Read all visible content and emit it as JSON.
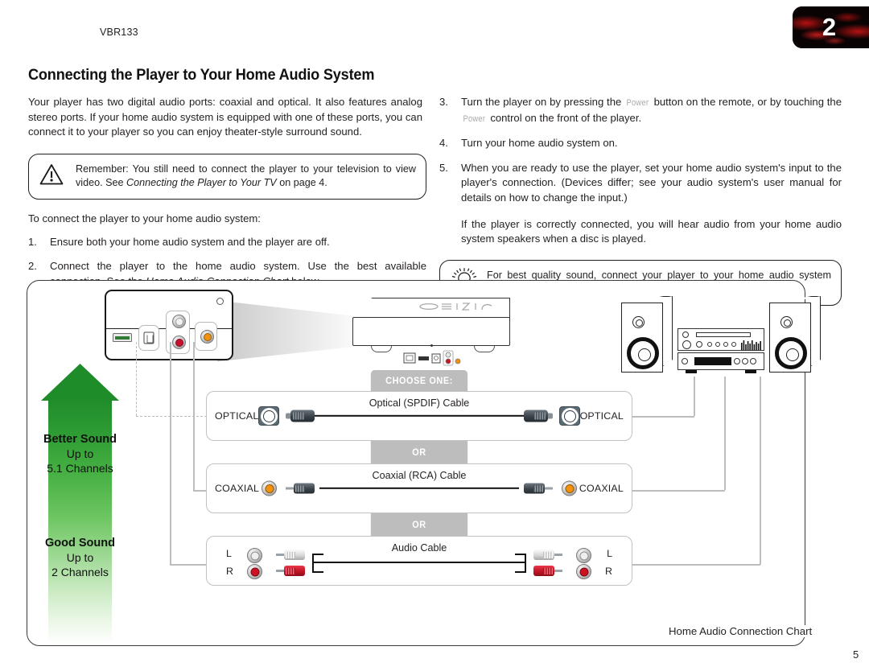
{
  "header": {
    "model_id": "VBR133",
    "chapter_number": "2",
    "page_title": "Connecting the Player to Your Home Audio System",
    "page_number": "5"
  },
  "left_column": {
    "intro": "Your player has two digital audio ports: coaxial and optical. It also features analog stereo ports. If your home audio system is equipped with one of these ports, you can connect it to your player so you can enjoy theater-style surround sound.",
    "warning": {
      "icon": "warning-triangle-icon",
      "text_before": "Remember: You still need to connect the player to your television to view video. See ",
      "text_italic": "Connecting the Player to Your TV",
      "text_after": " on page 4."
    },
    "lead_in": "To connect the player to your home audio system:",
    "steps": [
      {
        "number": "1.",
        "text": "Ensure both your home audio system and the player are off."
      },
      {
        "number": "2.",
        "text_before": "Connect the player to the home audio system. Use the best available connection. See the ",
        "text_italic": "Home Audio Connection Chart",
        "text_after": " below."
      }
    ]
  },
  "right_column": {
    "steps": [
      {
        "number": "3.",
        "part1": "Turn the player on by pressing the ",
        "key1": "Power",
        "part2": " button on the remote, or by touching the ",
        "key2": "Power",
        "part3": " control on the front of the player."
      },
      {
        "number": "4.",
        "text": "Turn your home audio system on."
      },
      {
        "number": "5.",
        "text": "When you are ready to use the player, set your home audio system's input to the player's connection. (Devices differ; see your audio system's user manual for details on how to change the input.)",
        "sub_text": "If the player is correctly connected, you will hear audio from your home audio system speakers when a disc is played."
      }
    ],
    "tip": {
      "icon": "lightbulb-icon",
      "text": "For best quality sound, connect your player to your home audio system using an HDMI cable. See the next page for instructions."
    }
  },
  "chart": {
    "caption": "Home Audio Connection Chart",
    "quality_arrow": {
      "better": {
        "title": "Better Sound",
        "line2": "Up to",
        "line3": "5.1 Channels"
      },
      "good": {
        "title": "Good Sound",
        "line2": "Up to",
        "line3": "2 Channels"
      }
    },
    "choose_one_label": "CHOOSE ONE:",
    "or_label": "OR",
    "rows": [
      {
        "id": "optical",
        "left_label": "OPTICAL",
        "right_label": "OPTICAL",
        "cable_name": "Optical (SPDIF) Cable",
        "port_icon": "toslink-port-icon",
        "connector_color": "#39424a"
      },
      {
        "id": "coaxial",
        "left_label": "COAXIAL",
        "right_label": "COAXIAL",
        "cable_name": "Coaxial (RCA) Cable",
        "port_icon": "rca-jack-icon",
        "connector_color": "#f5920b"
      },
      {
        "id": "audio",
        "left_label_l": "L",
        "left_label_r": "R",
        "right_label_l": "L",
        "right_label_r": "R",
        "cable_name": "Audio Cable",
        "port_icon_l": "rca-jack-white-icon",
        "port_icon_r": "rca-jack-red-icon",
        "connector_color_l": "#efefef",
        "connector_color_r": "#cc1122"
      }
    ],
    "device": {
      "name": "blu-ray-player-illustration",
      "ports": [
        "hdmi-port-icon",
        "optical-port-icon",
        "rca-left-jack-icon",
        "rca-right-jack-icon",
        "coaxial-jack-icon"
      ]
    },
    "audio_system": {
      "name": "home-audio-system-illustration",
      "parts": [
        "left-speaker",
        "receiver",
        "right-speaker"
      ]
    }
  },
  "colors": {
    "green_dark": "#1f8c2a",
    "green_light": "#ffffff",
    "gray_tab": "#bdbdbd",
    "orange": "#f5920b",
    "red": "#cc1122",
    "badge_red": "#c81414"
  }
}
